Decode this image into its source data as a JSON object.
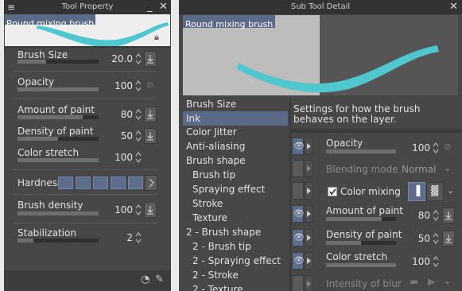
{
  "left_panel": {
    "title": "Tool Property",
    "brush_name": "Round mixing brush",
    "properties": [
      {
        "label": "Brush Size",
        "value": "20.0",
        "fill": 0.35
      },
      {
        "label": "Opacity",
        "value": "100",
        "fill": 1.0
      },
      {
        "label": "Amount of paint",
        "value": "80",
        "fill": 0.8
      },
      {
        "label": "Density of paint",
        "value": "50",
        "fill": 0.5
      },
      {
        "label": "Color stretch",
        "value": "100",
        "fill": 1.0
      },
      {
        "label": "Hardness",
        "value": ""
      },
      {
        "label": "Brush density",
        "value": "100",
        "fill": 1.0
      },
      {
        "label": "Stabilization",
        "value": "2",
        "fill": 0.2
      }
    ]
  },
  "right_panel": {
    "title": "Sub Tool Detail",
    "brush_name": "Round mixing brush",
    "categories": [
      "Brush Size",
      "Ink",
      "Color Jitter",
      "Anti-aliasing",
      "Brush shape",
      "Brush tip",
      "Spraying effect",
      "Stroke",
      "Texture",
      "2 - Brush shape",
      "2 - Brush tip",
      "2 - Spraying effect",
      "2 - Stroke",
      "2 - Texture"
    ],
    "selected_category": "Ink",
    "description": "Settings for how the brush behaves on the layer.",
    "settings": [
      {
        "label": "Opacity",
        "value": "100",
        "fill": 1.0
      },
      {
        "label": "Blending mode",
        "value": "Normal"
      },
      {
        "label": "Color mixing",
        "value": ""
      },
      {
        "label": "Amount of paint",
        "value": "80",
        "fill": 0.8
      },
      {
        "label": "Density of paint",
        "value": "50",
        "fill": 0.5
      },
      {
        "label": "Color stretch",
        "value": "100",
        "fill": 1.0
      },
      {
        "label": "Intensity of blur",
        "value": ""
      }
    ]
  },
  "colors": {
    "accent": "#4ec7cf",
    "selection": "#5b6a86",
    "panel": "#474747",
    "titlebar": "#333333"
  }
}
